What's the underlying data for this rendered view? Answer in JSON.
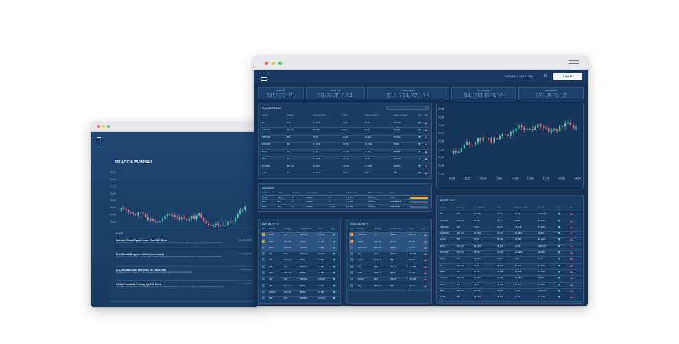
{
  "colors": {
    "up": "#52c9a4",
    "down": "#ea6f81",
    "accent": "#f3a23a"
  },
  "back_window": {
    "title": "TODAY'S MARKET",
    "chart_y_ticks": [
      "70.50",
      "70.50",
      "70.50",
      "70.50",
      "70.50",
      "70.50",
      "70.50",
      "70.50",
      "70.50"
    ],
    "chart_x_ticks": [
      "10:00",
      "11:00",
      "12:00",
      "13:00",
      "14:00",
      "15:00",
      "16:00",
      "17:00",
      "18:00"
    ],
    "news": {
      "heading": "NEWS",
      "items": [
        {
          "title": "Peloton Shares Open Lower Than IPO Price",
          "desc": "Shares of Peloton Interactive started trading Thursday at $27 a share, nearly 7% lower than the $29 price set in the company's initial public offering.",
          "date": "Thu, 26 Sep 2019"
        },
        {
          "title": "U.S. Stocks Drop on Political Uncertainty",
          "desc": "U.S. stocks fell as the release of a whistleblower complaint that has sparked an impeachment push President Trump clouded the political outlook.",
          "date": "Thu, 26 Sep 2019"
        },
        {
          "title": "U.S. Stocks Climb on Hopes for Trade Deal",
          "desc": "U.S. stocks climbed on hopes for a trade deal and investors assessed political uncertainty in Washington.",
          "date": "Thu, 26 Sep 2019"
        },
        {
          "title": "GlobalFoundries Firming Up IPO Plans",
          "desc": "Chip maker GlobalFoundries is firming up plans to go public, the chief executive said, in a move that could give the company access to public capital.",
          "date": "Thu, 26 Sep 2019"
        }
      ]
    }
  },
  "front_window": {
    "datetime": "9/19/2019, 1:35:41 PM",
    "user": "Alba Li",
    "stats": [
      {
        "label": "Real P&L",
        "value": "$8,672.15"
      },
      {
        "label": "Unreal P&L",
        "value": "$107,357.24"
      },
      {
        "label": "Market Value",
        "value": "$13,714,723.13"
      },
      {
        "label": "Net Liquidity",
        "value": "$4,093,823.62"
      },
      {
        "label": "Cash Balance",
        "value": "$29,825.82"
      }
    ],
    "market_data": {
      "title": "MARKET DATA",
      "headers": [
        "Symbol",
        "Strategy",
        "Average Price",
        "Price",
        "Volume Traded",
        "Volume Change",
        "Buy",
        "Sell"
      ],
      "rows": [
        [
          "BA",
          "RSI",
          "73.2423",
          "49.18",
          "36.44",
          "100.00%"
        ],
        [
          "USDCHF",
          "RSI, UA",
          "68.536",
          "55.21",
          "55.42",
          "98.15%"
        ],
        [
          "GBPUSD",
          "RSI",
          "79.34",
          "32.55",
          "44.116",
          "97.24%"
        ],
        [
          "EURUSD",
          "RSI",
          "73.2423",
          "23.734",
          "15.7324",
          "0.00%"
        ],
        [
          "GCV9",
          "RSI",
          "79.34",
          "56.236",
          "35.895",
          "99.94%"
        ],
        [
          "BIDU",
          "RSI",
          "73.2423",
          "20.820",
          "20.00",
          "100.00%"
        ],
        [
          "BTCUSD",
          "RSI, UA",
          "68.536",
          "22.449",
          "21.1983",
          "94.28%"
        ],
        [
          "AAPL",
          "RSI",
          "73.2423",
          "11.36",
          "6.98",
          "63.72"
        ]
      ]
    },
    "orders": {
      "title": "ORDERS",
      "headers": [
        "Symbol",
        "Action",
        "Quantity",
        "Quantity Type",
        "Value",
        "Time Placed",
        "Time Executed",
        "Status"
      ],
      "rows": [
        [
          "AABA",
          "SELL",
          "1",
          "quantity",
          "0",
          "4:18 PM",
          "4:21 PM",
          "OPEN"
        ],
        [
          "BRB",
          "BUY",
          "1",
          "quantity",
          "0",
          "2:16 PM",
          "2:16 PM",
          "CANCELLED"
        ],
        [
          "BIDU",
          "BUY",
          "1",
          "quantity",
          "3.70%",
          "4:21 PM",
          "4:22 PM",
          "EXECUTED"
        ]
      ]
    },
    "buy_alerts": {
      "title": "BUY ALERTS",
      "headers": [
        "Set",
        "Symbol",
        "Strategy",
        "Average Price",
        "Price",
        "Buy"
      ],
      "rows": [
        [
          "AABA",
          "RSI",
          "73.2423",
          "142.532"
        ],
        [
          "BRB",
          "RSI, UA",
          "68.536",
          "41.532"
        ],
        [
          "BIDU",
          "RSI, UA",
          "73.2423",
          "73.812"
        ],
        [
          "GM",
          "RSI",
          "73.2423",
          "142.532"
        ],
        [
          "ABT",
          "RSI, UA",
          "79.34",
          "73.812"
        ],
        [
          "ABT",
          "RSI",
          "73.2423",
          "73.812"
        ],
        [
          "ADP",
          "RSI, UA",
          "68.536",
          "41.532"
        ],
        [
          "GM",
          "RSI",
          "73.2423",
          "142.532"
        ],
        [
          "ABT",
          "RSI, UA",
          "79.34",
          "73.812"
        ],
        [
          "GOOGL",
          "RSI, UA",
          "68.536",
          "41.532"
        ],
        [
          "ABT",
          "RSI",
          "73.2423",
          "142.532"
        ]
      ]
    },
    "sell_alerts": {
      "title": "SELL ALERTS",
      "headers": [
        "Set",
        "Symbol",
        "Strategy",
        "Average Price",
        "Price",
        "Sell"
      ],
      "rows": [
        [
          "USDCHF",
          "RSI",
          "73.2423",
          "142.532"
        ],
        [
          "BIDU",
          "RSI, UA",
          "68.536",
          "41.532"
        ],
        [
          "BTCUSD",
          "RSI, UA",
          "73.2423",
          "73.812"
        ],
        [
          "BA",
          "RSI",
          "73.2423",
          "142.532"
        ],
        [
          "AAPL",
          "RSI, UA",
          "79.34",
          "73.812"
        ],
        [
          "BA",
          "RSI",
          "73.2423",
          "142.532"
        ],
        [
          "ADP",
          "RSI, UA",
          "68.536",
          "41.532"
        ],
        [
          "GCV9",
          "RSI",
          "73.2423",
          "142.532"
        ],
        [
          "BA",
          "RSI, UA",
          "79.34",
          "73.812"
        ]
      ]
    },
    "chart": {
      "y_ticks": [
        "70.50",
        "70.50",
        "70.50",
        "70.50",
        "70.50",
        "70.50",
        "70.50",
        "70.50",
        "70.50"
      ],
      "x_ticks": [
        "10:00",
        "11:00",
        "12:00",
        "13:00",
        "14:00",
        "15:00",
        "16:00",
        "17:00",
        "18:00"
      ]
    },
    "positions": {
      "title": "POSITIONS",
      "headers": [
        "Symbol",
        "Strategy",
        "Average Price",
        "Price",
        "Purchased Price",
        "% Gain",
        "Buy",
        "Sell"
      ],
      "rows": [
        [
          "BA",
          "RSI",
          "73.2423",
          "49.18",
          "36.44",
          "100.00%"
        ],
        [
          "USDCHF",
          "RSI, UA",
          "68.536",
          "55.21",
          "55.42",
          "98.15%"
        ],
        [
          "GBPUSD",
          "RSI",
          "79.34",
          "32.55",
          "44.116",
          "97.24%"
        ],
        [
          "EURUSD",
          "RSI, UA",
          "73.2423",
          "23.734",
          "15.7324",
          "0.00%"
        ],
        [
          "GCV9",
          "RSI",
          "79.34",
          "56.236",
          "35.895",
          "99.94%"
        ],
        [
          "BIDU",
          "RSI, UA",
          "73.2423",
          "20.820",
          "20.00",
          "100.00%"
        ],
        [
          "BTCUSD",
          "RSI, UA",
          "68.536",
          "22.449",
          "21.1983",
          "94.28%"
        ],
        [
          "AAPL",
          "RSI",
          "73.2423",
          "11.36",
          "6.98",
          "63.72"
        ],
        [
          "C",
          "RSI, UA",
          "79.34",
          "56.236",
          "35.895",
          "98.15%"
        ],
        [
          "MSFT",
          "RSI",
          "68.536",
          "44.116",
          "44.116",
          "97.24%"
        ],
        [
          "GOOGL",
          "RSI, UA",
          "73.2423",
          "23.734",
          "15.7324",
          "0.00%"
        ],
        [
          "ADP",
          "RSI",
          "79.34",
          "56.236",
          "35.895",
          "99.94%"
        ],
        [
          "BRB",
          "RSI, UA",
          "73.2423",
          "20.820",
          "20.00",
          "100.00%"
        ],
        [
          "AABA",
          "RSI",
          "73.2423",
          "20.820",
          "20.00",
          "94.28%"
        ]
      ]
    }
  }
}
